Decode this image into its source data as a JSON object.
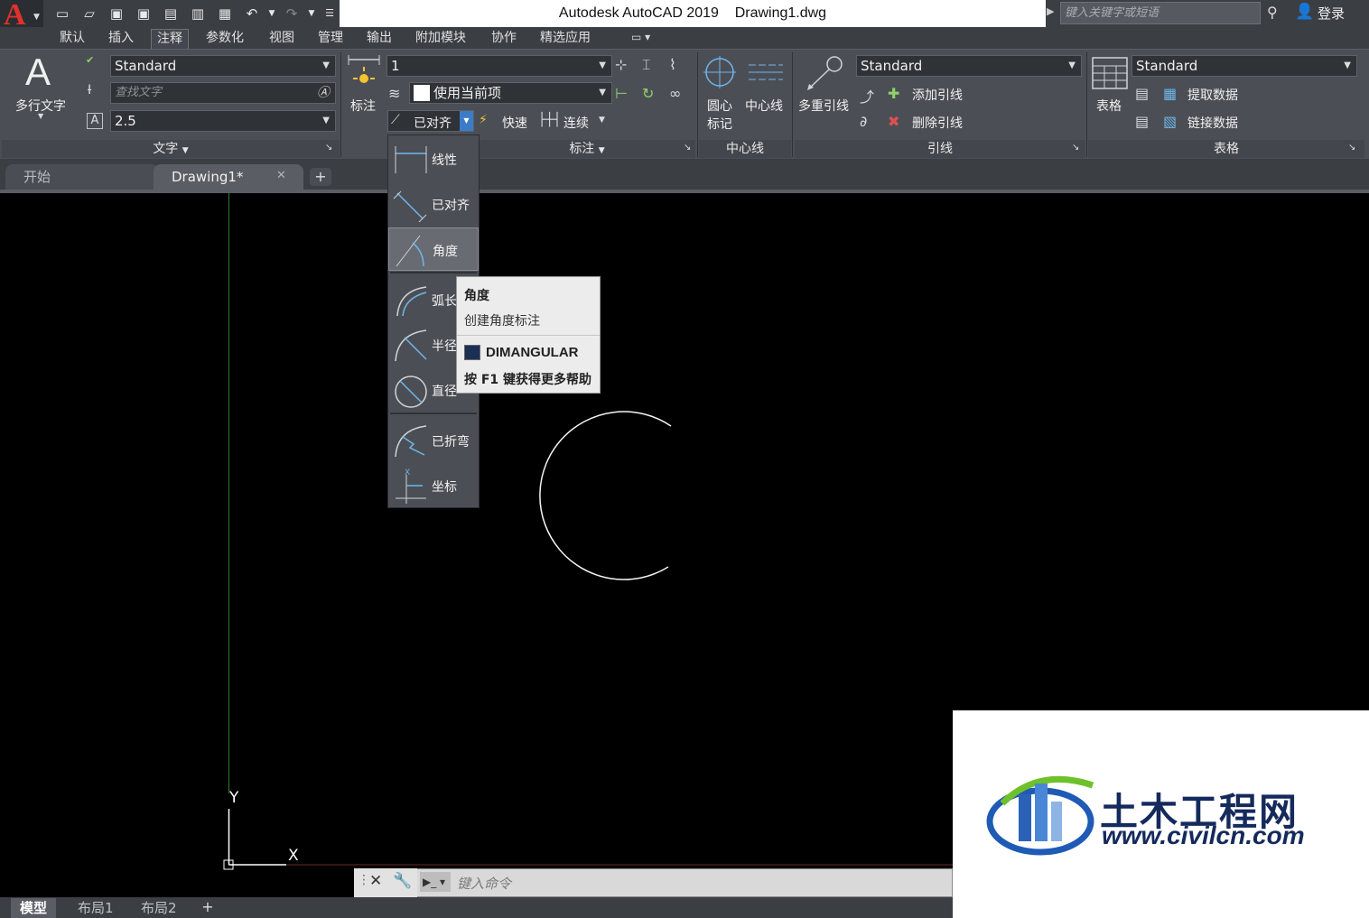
{
  "app": {
    "title": "Autodesk AutoCAD 2019    Drawing1.dwg",
    "search_placeholder": "键入关键字或短语",
    "login": "登录"
  },
  "menu_tabs": [
    "默认",
    "插入",
    "注释",
    "参数化",
    "视图",
    "管理",
    "输出",
    "附加模块",
    "协作",
    "精选应用"
  ],
  "ribbon": {
    "text_panel": {
      "big_button": "多行文字",
      "style": "Standard",
      "find_placeholder": "查找文字",
      "height": "2.5",
      "footer": "文字"
    },
    "dim_panel": {
      "big_button": "标注",
      "dim_style": "1",
      "layer": "使用当前项",
      "aligned": "已对齐",
      "quick": "快速",
      "continue": "连续",
      "footer": "标注"
    },
    "centerline_panel": {
      "center_mark_1": "圆心",
      "center_mark_2": "标记",
      "centerline": "中心线",
      "footer": "中心线"
    },
    "leader_panel": {
      "big_button": "多重引线",
      "style": "Standard",
      "add": "添加引线",
      "remove": "删除引线",
      "footer": "引线"
    },
    "table_panel": {
      "big_button": "表格",
      "style": "Standard",
      "extract": "提取数据",
      "link": "链接数据",
      "footer": "表格"
    }
  },
  "file_tabs": {
    "start": "开始",
    "drawing": "Drawing1*"
  },
  "dim_menu": [
    "线性",
    "已对齐",
    "角度",
    "弧长",
    "半径",
    "直径",
    "已折弯",
    "坐标"
  ],
  "tooltip": {
    "title": "角度",
    "desc": "创建角度标注",
    "command": "DIMANGULAR",
    "help": "按 F1 键获得更多帮助"
  },
  "ucs": {
    "x": "X",
    "y": "Y"
  },
  "command_line": {
    "placeholder": "键入命令"
  },
  "layout_tabs": [
    "模型",
    "布局1",
    "布局2"
  ],
  "watermark": {
    "text": "土木工程网",
    "url": "www.civilcn.com"
  }
}
